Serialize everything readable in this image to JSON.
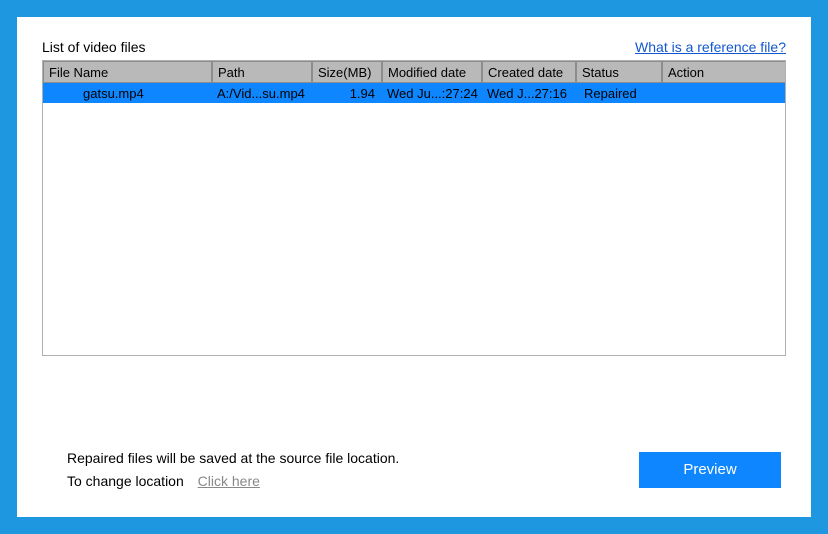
{
  "title": "List of video files",
  "reference_link": "What is a reference file?",
  "columns": {
    "filename": "File Name",
    "path": "Path",
    "size": "Size(MB)",
    "modified": "Modified date",
    "created": "Created date",
    "status": "Status",
    "action": "Action"
  },
  "rows": [
    {
      "filename": "gatsu.mp4",
      "path": "A:/Vid...su.mp4",
      "size": "1.94",
      "modified": "Wed Ju...:27:24",
      "created": "Wed J...27:16",
      "status": "Repaired",
      "action": ""
    }
  ],
  "footer": {
    "line1": "Repaired files will be saved at the source file location.",
    "line2_prefix": "To change location",
    "click_here": "Click here"
  },
  "preview_button": "Preview"
}
